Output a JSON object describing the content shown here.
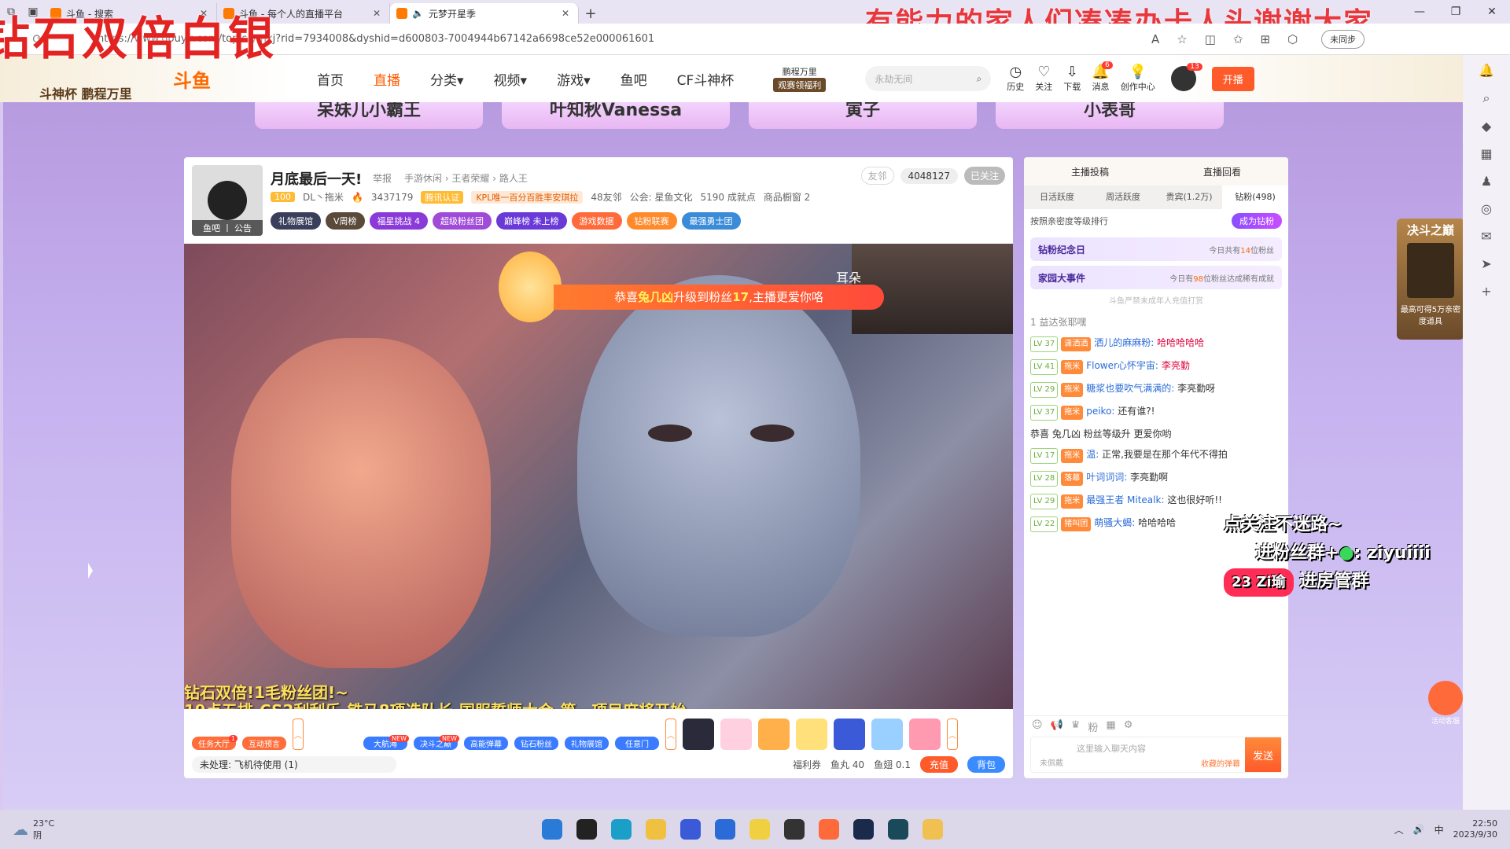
{
  "browser": {
    "tabs": [
      {
        "title": "斗鱼 - 搜索",
        "active": false
      },
      {
        "title": "斗鱼 - 每个人的直播平台",
        "active": false
      },
      {
        "title": "元梦开星季",
        "active": true
      }
    ],
    "url": "https://www.douyu.com/topic/ymxj?rid=7934008&dyshid=d600803-7004944b67142a6698ce52e000061601",
    "sync_label": "未同步",
    "overlay_banner": "有能力的家人们凑凑办卡人头谢谢大家",
    "overlay_left": "钻石双倍白银"
  },
  "header": {
    "cup_text": "斗神杯 鹏程万里",
    "logo": "斗鱼",
    "nav": [
      "首页",
      "直播",
      "分类",
      "视频",
      "游戏",
      "鱼吧",
      "CF斗神杯"
    ],
    "active_nav": "直播",
    "promo": {
      "top": "鹏程万里",
      "tag": "观赛领福利"
    },
    "search_placeholder": "永劫无间",
    "icons": [
      {
        "label": "历史",
        "badge": ""
      },
      {
        "label": "关注",
        "badge": ""
      },
      {
        "label": "下载",
        "badge": ""
      },
      {
        "label": "消息",
        "badge": "6"
      },
      {
        "label": "创作中心",
        "badge": ""
      }
    ],
    "avatar_badge": "13",
    "start_btn": "开播"
  },
  "recommend": [
    "呆妹儿小霸王",
    "叶知秋Vanessa",
    "寅子",
    "小表哥"
  ],
  "room": {
    "title": "月底最后一天!",
    "report": "举报",
    "category": "手游休闲 › 王者荣耀 › 路人王",
    "level": "100",
    "anchor": "DL丶拖米",
    "hot": "3437179",
    "verified": "腾讯认证",
    "kpl": "KPL唯一百分百胜率安琪拉",
    "friends": "48友邻",
    "guild": "公会: 星鱼文化",
    "achievements": "5190 成就点",
    "shop": "商品橱窗 2",
    "avatar_footer": "鱼吧 丨 公告",
    "friend_btn": "友邻",
    "fans": "4048127",
    "followed": "已关注",
    "badges": [
      "礼物展馆",
      "V周榜",
      "福星挑战 4",
      "超级粉丝团",
      "巅峰榜 未上榜",
      "游戏数据",
      "钻粉联赛",
      "最强勇士团"
    ]
  },
  "video": {
    "upgrade_msg_pre": "恭喜",
    "upgrade_user": "兔几凶",
    "upgrade_msg_mid": "升级到粉丝",
    "upgrade_level": "17",
    "upgrade_msg_post": ",主播更爱你咯",
    "cam_text": "耳朵",
    "danmu1": "钻石双倍!1毛粉丝团!~",
    "danmu2": "19点五排-CS2刮刮乐-铁马8项选队长-国服誓师大会-第一项目麻将开始"
  },
  "toolbar": {
    "tools": [
      {
        "label": "任务大厅",
        "new": "1"
      },
      {
        "label": "互动预言",
        "new": ""
      },
      {
        "label": "大航海",
        "new": "NEW"
      },
      {
        "label": "决斗之巅",
        "new": "NEW"
      },
      {
        "label": "高能弹幕",
        "new": ""
      },
      {
        "label": "钻石粉丝",
        "new": ""
      },
      {
        "label": "礼物展馆",
        "new": ""
      },
      {
        "label": "任意门",
        "new": ""
      }
    ],
    "pending": "未处理: 飞机待使用 (1)",
    "welfare": "福利券",
    "fishball": "鱼丸 40",
    "fishwing": "鱼翅 0.1",
    "recharge": "充值",
    "bag": "背包"
  },
  "chat": {
    "top": [
      "主播投稿",
      "直播回看"
    ],
    "tabs": [
      "日活跃度",
      "周活跃度",
      "贵宾(1.2万)",
      "钻粉(498)"
    ],
    "rank_label": "按照亲密度等级排行",
    "rank_btn": "成为钻粉",
    "notice1": {
      "title": "钻粉纪念日",
      "sub_pre": "今日共有",
      "sub_num": "14",
      "sub_post": "位粉丝"
    },
    "notice2": {
      "title": "家园大事件",
      "sub_pre": "今日有",
      "sub_num": "98",
      "sub_post": "位粉丝达成稀有成就"
    },
    "warn": "斗鱼严禁未成年人充值打赏",
    "top_fan": "1 益达张耶嘿",
    "messages": [
      {
        "lv": "LV 37",
        "badge": "潇洒洒",
        "user": "洒儿的麻麻粉:",
        "text": "哈哈哈哈哈"
      },
      {
        "lv": "LV 41",
        "badge": "拖米",
        "user": "Flower心怀宇宙:",
        "text": "李亮勤"
      },
      {
        "lv": "LV 29",
        "badge": "拖米",
        "user": "糖浆也要吹气满满的:",
        "text": "李亮勤呀"
      },
      {
        "lv": "LV 37",
        "badge": "拖米",
        "user": "peiko:",
        "text": "还有谁?!"
      },
      {
        "lv": "",
        "badge": "",
        "user": "恭喜 兔几凶 粉丝等级升",
        "text": "更爱你哟"
      },
      {
        "lv": "LV 17",
        "badge": "拖米",
        "user": "温:",
        "text": "正常,我要是在那个年代不得拍"
      },
      {
        "lv": "LV 28",
        "badge": "落幕",
        "user": "叶词词词:",
        "text": "李亮勤啊"
      },
      {
        "lv": "LV 29",
        "badge": "拖米",
        "user": "最强王者 Mitealk:",
        "text": "这也很好听!!"
      },
      {
        "lv": "LV 22",
        "badge": "猪叫团",
        "user": "萌骚大蝎:",
        "text": "哈哈哈哈"
      }
    ],
    "sleeping": "未佩戴",
    "input_placeholder": "这里输入聊天内容",
    "barrage": "收藏的弹幕",
    "send": "发送"
  },
  "promo_right": {
    "line1": "点关注不迷路~",
    "line2": "进粉丝群+",
    "line2_id": ": ziyuiiii",
    "badge": "Zi瑜",
    "badge_num": "23",
    "line3": "进房管群"
  },
  "event_card": {
    "title": "决斗之巅",
    "desc": "最高可得5万亲密度道具"
  },
  "service": "活动客服",
  "taskbar": {
    "temp": "23°C",
    "weather": "阴",
    "time": "22:50",
    "date": "2023/9/30",
    "ime": "中"
  }
}
